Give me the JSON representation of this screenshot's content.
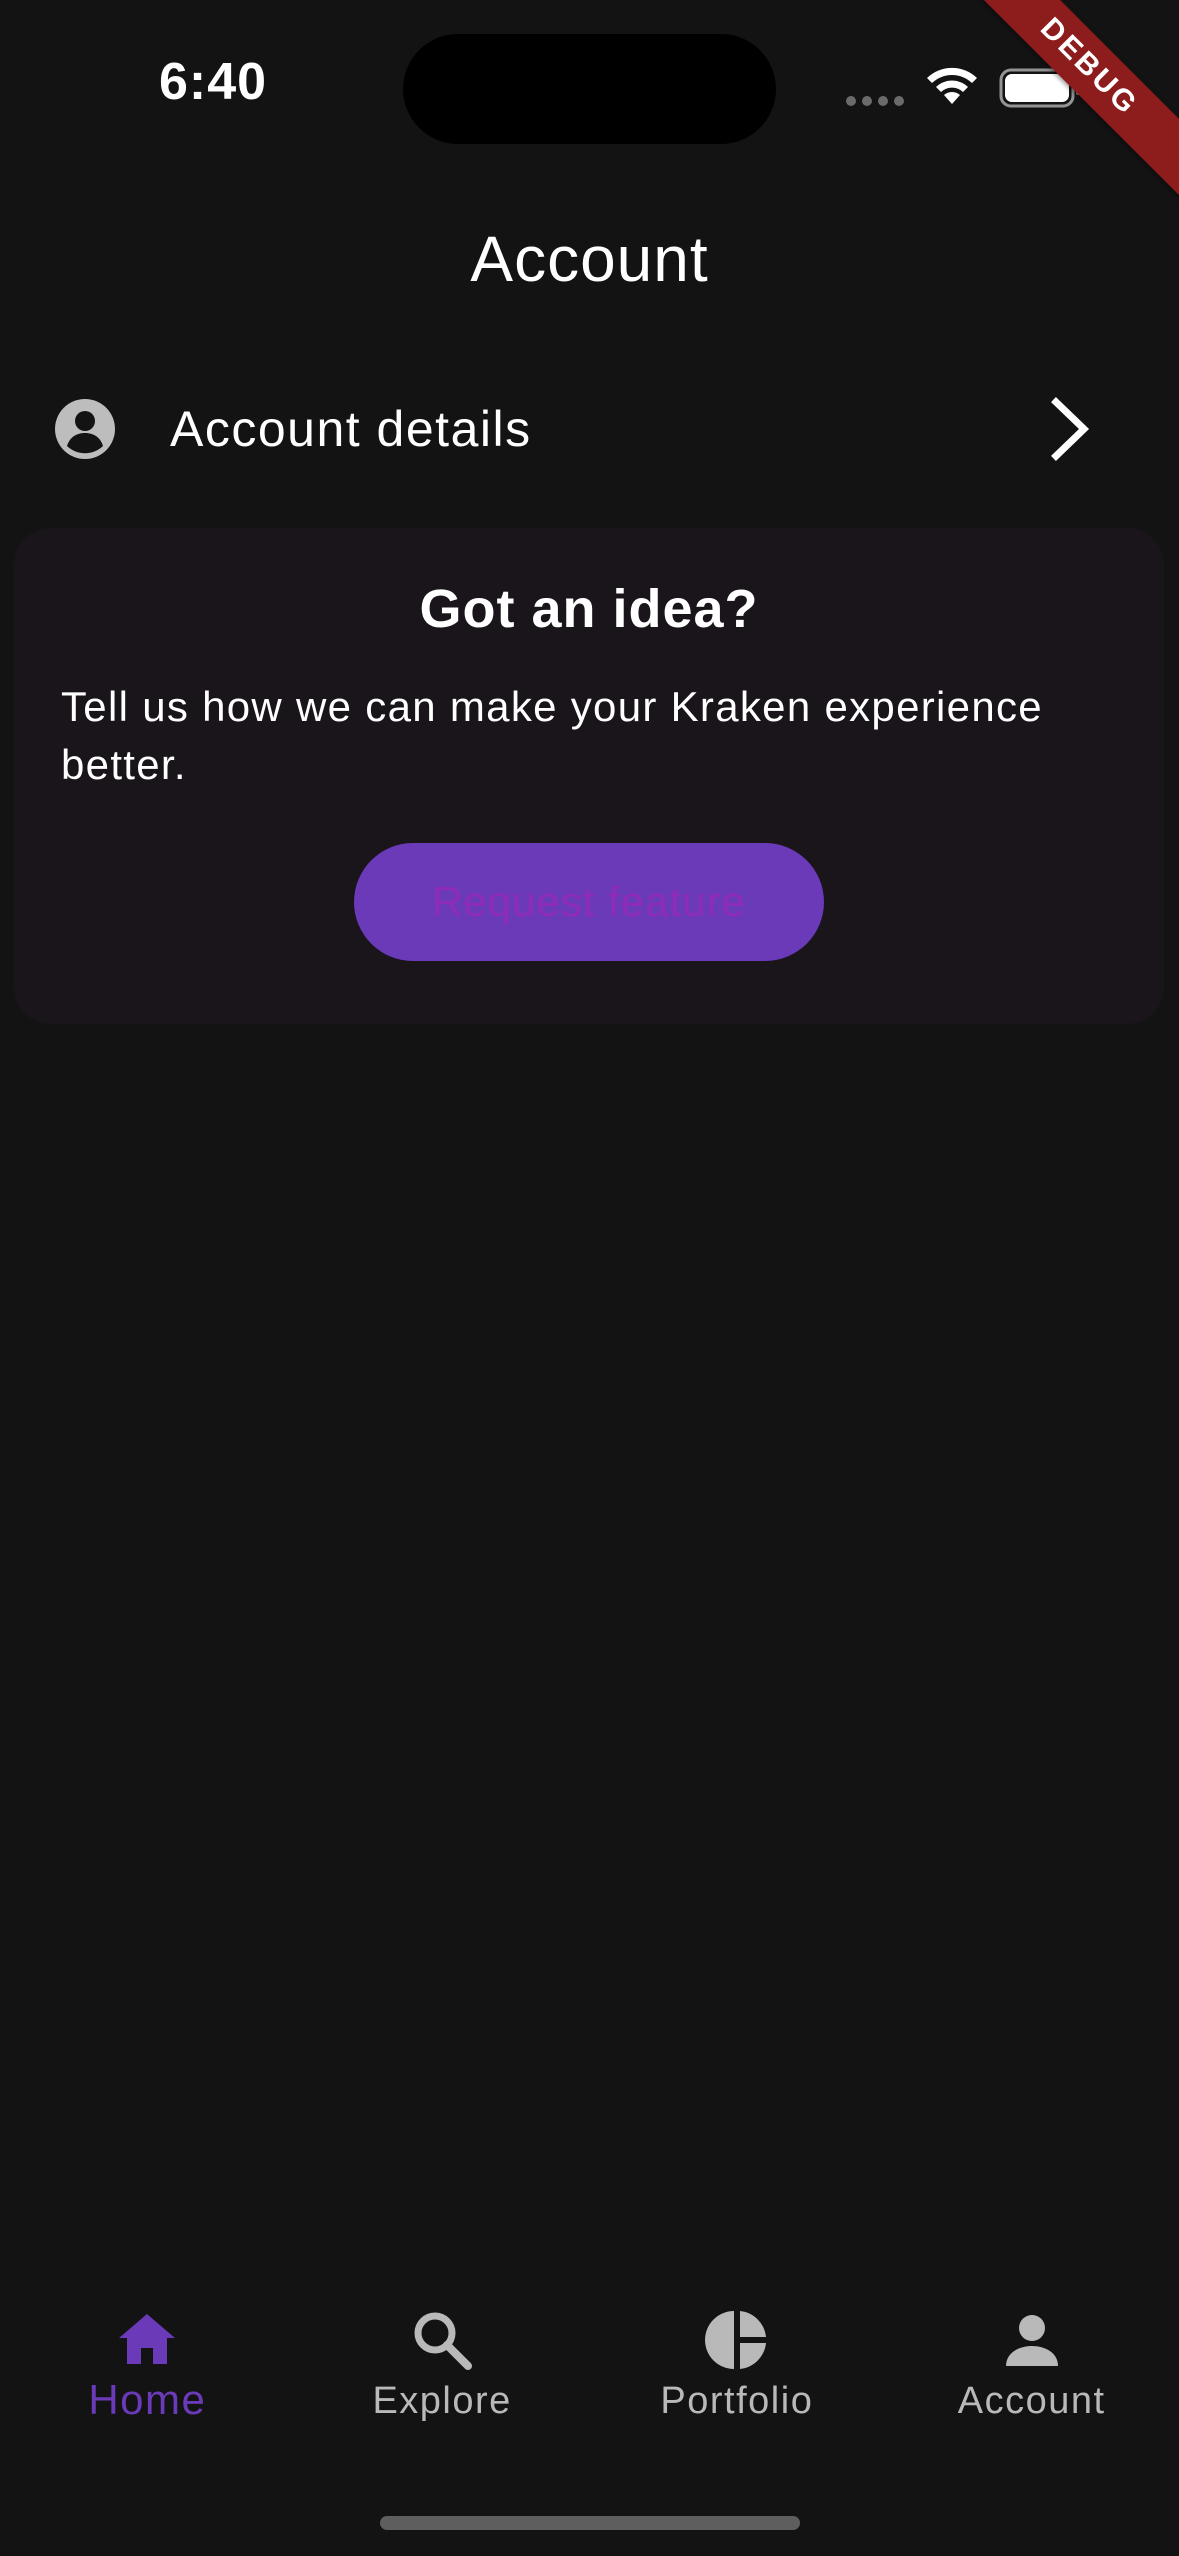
{
  "status_bar": {
    "time": "6:40"
  },
  "debug_banner": "DEBUG",
  "header": {
    "title": "Account"
  },
  "account_row": {
    "icon": "account-circle-icon",
    "label": "Account details",
    "chevron": "chevron-right-icon"
  },
  "idea_card": {
    "title": "Got an idea?",
    "body": "Tell us how we can make your Kraken experience better.",
    "button_label": "Request feature"
  },
  "bottom_nav": {
    "items": [
      {
        "label": "Home",
        "icon": "home-icon",
        "active": true
      },
      {
        "label": "Explore",
        "icon": "search-icon",
        "active": false
      },
      {
        "label": "Portfolio",
        "icon": "pie-chart-icon",
        "active": false
      },
      {
        "label": "Account",
        "icon": "person-icon",
        "active": false
      }
    ]
  },
  "colors": {
    "background": "#131313",
    "card_background": "#1a141b",
    "accent": "#6a3ab8",
    "inactive_nav": "#b9b9b9",
    "debug_banner": "#8d1d1d"
  }
}
